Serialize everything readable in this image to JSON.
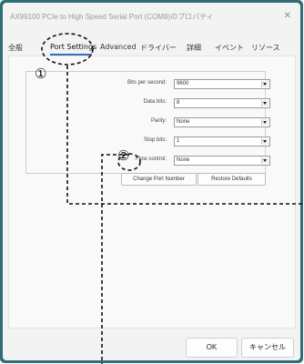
{
  "window": {
    "title": "AX99100 PCIe to High Speed Serial Port (COM8)のプロパティ",
    "close_icon": "close-icon"
  },
  "tabs": [
    "全般",
    "Port Settings",
    "Advanced",
    "ドライバー",
    "詳細",
    "イベント",
    "リソース"
  ],
  "active_tab": "Port Settings",
  "port_settings": {
    "fields": [
      {
        "label": "Bits per second:",
        "value": "9600"
      },
      {
        "label": "Data bits:",
        "value": "8"
      },
      {
        "label": "Parity:",
        "value": "None"
      },
      {
        "label": "Stop bits:",
        "value": "1"
      },
      {
        "label": "Flow control:",
        "value": "None"
      }
    ],
    "change_port_number": "Change Port Number",
    "restore_defaults": "Restore Defaults"
  },
  "footer": {
    "ok": "OK",
    "cancel": "キャンセル"
  },
  "annotations": {
    "marker_1": "①",
    "marker_2": "②"
  }
}
